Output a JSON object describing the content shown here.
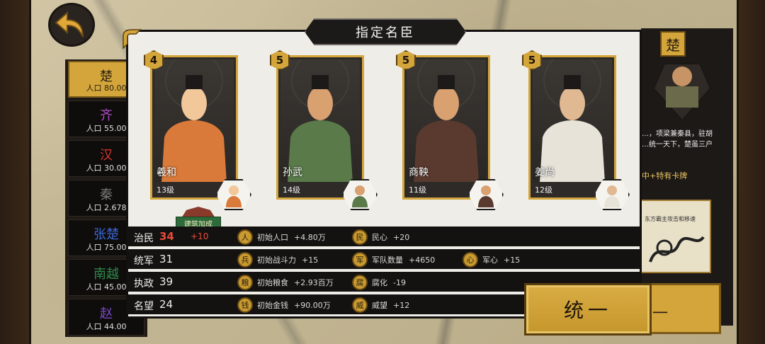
{
  "modal": {
    "title": "指定名臣"
  },
  "kingdoms": [
    {
      "name": "楚",
      "pop": "人口 80.00",
      "color": "#d3a53a"
    },
    {
      "name": "齐",
      "pop": "人口 55.00",
      "color": "#b24ac9"
    },
    {
      "name": "汉",
      "pop": "人口 30.00",
      "color": "#d6342b"
    },
    {
      "name": "秦",
      "pop": "人口 2.678",
      "color": "#777777"
    },
    {
      "name": "张楚",
      "pop": "人口 75.00",
      "color": "#3a66d6"
    },
    {
      "name": "南越",
      "pop": "人口 45.00",
      "color": "#2e8b4a"
    },
    {
      "name": "赵",
      "pop": "人口 44.00",
      "color": "#7a4ac9"
    }
  ],
  "ministers": [
    {
      "level_tag": "4",
      "name": "羲和",
      "level": "13级",
      "robe": "#d97a3a",
      "skin": "#f2c79a"
    },
    {
      "level_tag": "5",
      "name": "孙武",
      "level": "14级",
      "robe": "#5a7a4a",
      "skin": "#d9a070"
    },
    {
      "level_tag": "5",
      "name": "商鞅",
      "level": "11级",
      "robe": "#5a3a2e",
      "skin": "#d9a070"
    },
    {
      "level_tag": "5",
      "name": "姜尚",
      "level": "12级",
      "robe": "#e8e3d8",
      "skin": "#e0b892"
    }
  ],
  "building_bonus": "建筑加成",
  "stats": [
    {
      "label": "治民",
      "value": "34",
      "bonus": "+10",
      "effects": [
        {
          "icon": "人",
          "name": "初始人口",
          "value": "+4.80万"
        },
        {
          "icon": "民",
          "name": "民心",
          "value": "+20"
        }
      ]
    },
    {
      "label": "统军",
      "value": "31",
      "bonus": "",
      "effects": [
        {
          "icon": "兵",
          "name": "初始战斗力",
          "value": "+15"
        },
        {
          "icon": "军",
          "name": "军队数量",
          "value": "+4650"
        },
        {
          "icon": "心",
          "name": "军心",
          "value": "+15"
        }
      ]
    },
    {
      "label": "执政",
      "value": "39",
      "bonus": "",
      "effects": [
        {
          "icon": "粮",
          "name": "初始粮食",
          "value": "+2.93百万"
        },
        {
          "icon": "腐",
          "name": "腐化",
          "value": "-19"
        }
      ]
    },
    {
      "label": "名望",
      "value": "24",
      "bonus": "",
      "effects": [
        {
          "icon": "钱",
          "name": "初始金钱",
          "value": "+90.00万"
        },
        {
          "icon": "威",
          "name": "威望",
          "value": "+12"
        }
      ]
    }
  ],
  "unify_label": "统一",
  "unify_label_behind": "一",
  "right_panel": {
    "badge": "楚",
    "desc_lines": [
      "…，项梁兼秦县，驻胡",
      "…统一天下，楚虽三户"
    ],
    "special": "中+特有卡牌",
    "card_text": "东方霸主攻击和移速"
  }
}
